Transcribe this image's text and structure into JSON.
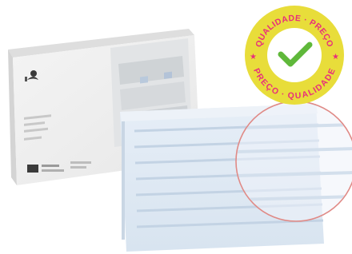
{
  "product_photo": {
    "badge": {
      "text_top": "QUALIDADE · PREÇO",
      "text_bottom": "PREÇO · QUALIDADE",
      "colors": {
        "ring": "#e8dd3a",
        "inner": "#ffffff",
        "text": "#e8307a",
        "check": "#5fb83a",
        "star": "#e8307a"
      }
    },
    "zoom_circle": {
      "stroke_color": "#e08a86"
    }
  }
}
